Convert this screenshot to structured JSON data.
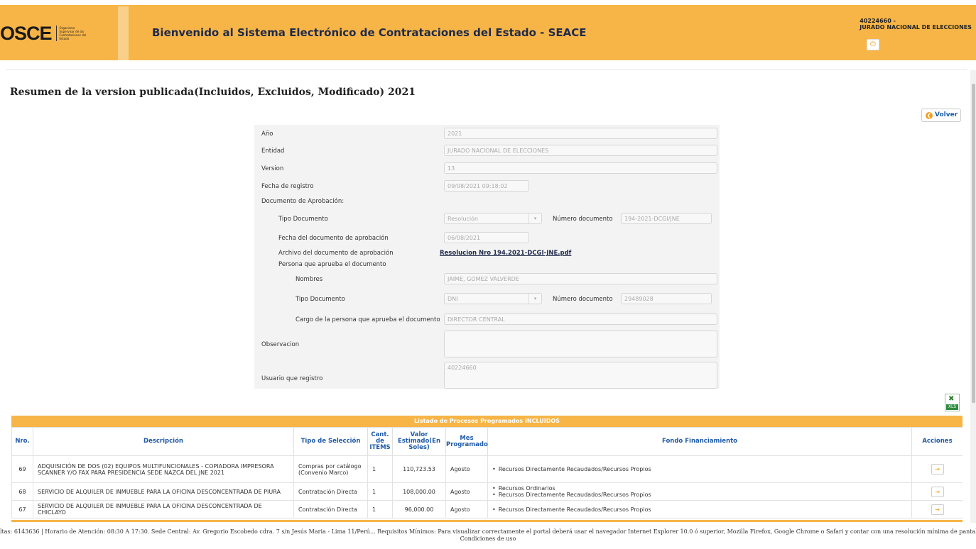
{
  "header": {
    "logo_text": "OSCE",
    "logo_sub": "Organismo Supervisor de las Contrataciones del Estado",
    "title": "Bienvenido al Sistema Electrónico de Contrataciones del Estado - SEACE",
    "user_line1": "40224660 -",
    "user_line2": "JURADO NACIONAL DE ELECCIONES",
    "logout_icon": "power-icon"
  },
  "page": {
    "title": "Resumen de la version publicada(Incluidos, Excluidos, Modificado) 2021",
    "back_label": "Volver"
  },
  "form": {
    "anio_label": "Año",
    "anio_value": "2021",
    "entidad_label": "Entidad",
    "entidad_value": "JURADO NACIONAL DE ELECCIONES",
    "version_label": "Version",
    "version_value": "13",
    "fecha_registro_label": "Fecha de registro",
    "fecha_registro_value": "09/08/2021 09:18:02",
    "doc_aprobacion_label": "Documento de Aprobación:",
    "tipo_doc_label": "Tipo Documento",
    "tipo_doc_value": "Resolución",
    "num_doc_label": "Número documento",
    "num_doc_value": "194-2021-DCGI/JNE",
    "fecha_doc_label": "Fecha del documento de aprobación",
    "fecha_doc_value": "06/08/2021",
    "archivo_label": "Archivo del documento de aprobación",
    "archivo_link": "Resolucion Nro 194.2021-DCGI-JNE.pdf",
    "persona_label": "Persona que aprueba el documento",
    "nombres_label": "Nombres",
    "nombres_value": "JAIME, GOMEZ VALVERDE",
    "persona_tipo_doc_label": "Tipo Documento",
    "persona_tipo_doc_value": "DNI",
    "persona_num_doc_label": "Número documento",
    "persona_num_doc_value": "29489028",
    "cargo_label": "Cargo de la persona que aprueba el documento",
    "cargo_value": "DIRECTOR CENTRAL",
    "observacion_label": "Observacion",
    "observacion_value": "",
    "usuario_label": "Usuario que registro",
    "usuario_value": "40224660"
  },
  "table": {
    "caption": "Listado de Procesos Programados INCLUIDOS",
    "headers": {
      "nro": "Nro.",
      "descripcion": "Descripción",
      "tipo": "Tipo de Selección",
      "cant": "Cant. de ITEMS",
      "valor": "Valor Estimado(En Soles)",
      "mes": "Mes Programado",
      "fondo": "Fondo Financiamiento",
      "acciones": "Acciones"
    },
    "rows": [
      {
        "nro": "69",
        "descripcion": "ADQUISICIÓN DE DOS (02) EQUIPOS MULTIFUNCIONALES - COPIADORA IMPRESORA SCANNER Y/O FAX PARA PRESIDENCIA SEDE NAZCA DEL JNE 2021",
        "tipo": "Compras por catálogo (Convenio Marco)",
        "cant": "1",
        "valor": "110,723.53",
        "mes": "Agosto",
        "fondo": [
          "Recursos Directamente Recaudados/Recursos Propios"
        ]
      },
      {
        "nro": "68",
        "descripcion": "SERVICIO DE ALQUILER DE INMUEBLE PARA LA OFICINA DESCONCENTRADA DE PIURA",
        "tipo": "Contratación Directa",
        "cant": "1",
        "valor": "108,000.00",
        "mes": "Agosto",
        "fondo": [
          "Recursos Ordinarios",
          "Recursos Directamente Recaudados/Recursos Propios"
        ]
      },
      {
        "nro": "67",
        "descripcion": "SERVICIO DE ALQUILER DE INMUEBLE PARA LA OFICINA DESCONCENTRADA DE CHICLAYO",
        "tipo": "Contratación Directa",
        "cant": "1",
        "valor": "96,000.00",
        "mes": "Agosto",
        "fondo": [
          "Recursos Directamente Recaudados/Recursos Propios"
        ]
      }
    ]
  },
  "export": {
    "label": "XLS"
  },
  "footer": {
    "text": "ltas: 6143636 | Horario de Atención: 08:30 A 17:30. Sede Central: Av. Gregorio Escobedo cdra. 7 s/n Jesús Maria - Lima 11/Perú... Requisitos Mínimos: Para visualizar correctamente el portal deberá usar el navegador Internet Explorer 10.0 ó superior, Mozilla Firefox, Google Chrome o Safari y contar con una resolución mínima de pantalla de 1280x600. Terminos y",
    "text2": "Condiciones de uso"
  }
}
